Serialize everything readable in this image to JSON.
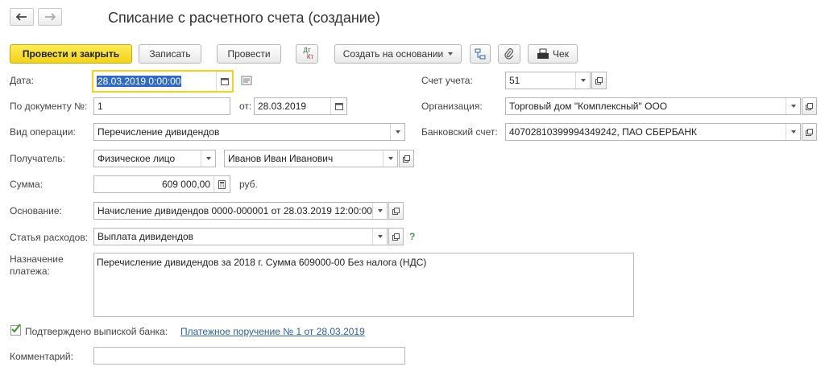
{
  "window": {
    "title": "Списание с расчетного счета (создание)"
  },
  "toolbar": {
    "post_close": "Провести и закрыть",
    "save": "Записать",
    "post": "Провести",
    "dtkt_top": "Дт",
    "dtkt_bottom": "Кт",
    "create_based": "Создать на основании",
    "receipt": "Чек"
  },
  "form": {
    "date_label": "Дата:",
    "date_value": "28.03.2019  0:00:00",
    "docnum_label": "По документу №:",
    "docnum_value": "1",
    "from_label": "от:",
    "from_value": "28.03.2019",
    "optype_label": "Вид операции:",
    "optype_value": "Перечисление дивидендов",
    "recipient_label": "Получатель:",
    "recipient_type": "Физическое лицо",
    "recipient_name": "Иванов Иван Иванович",
    "sum_label": "Сумма:",
    "sum_value": "609 000,00",
    "sum_currency": "руб.",
    "basis_label": "Основание:",
    "basis_value": "Начисление дивидендов 0000-000001 от 28.03.2019 12:00:00",
    "expense_label": "Статья расходов:",
    "expense_value": "Выплата дивидендов",
    "help": "?",
    "purpose_label_1": "Назначение",
    "purpose_label_2": "платежа:",
    "purpose_value": "Перечисление дивидендов за 2018 г. Сумма 609000-00 Без налога (НДС)",
    "confirmed_label": "Подтверждено выпиской банка:",
    "confirmed_checked": true,
    "payment_order_link": "Платежное поручение № 1 от 28.03.2019",
    "comment_label": "Комментарий:",
    "comment_value": "",
    "account_label": "Счет учета:",
    "account_value": "51",
    "org_label": "Организация:",
    "org_value": "Торговый дом \"Комплексный\" ООО",
    "bank_label": "Банковский счет:",
    "bank_value": "40702810399994349242, ПАО СБЕРБАНК"
  },
  "colors": {
    "primary": "#f2d21b",
    "link": "#2d5f9a",
    "selection": "#316ac5",
    "check": "#3a9a2a"
  }
}
